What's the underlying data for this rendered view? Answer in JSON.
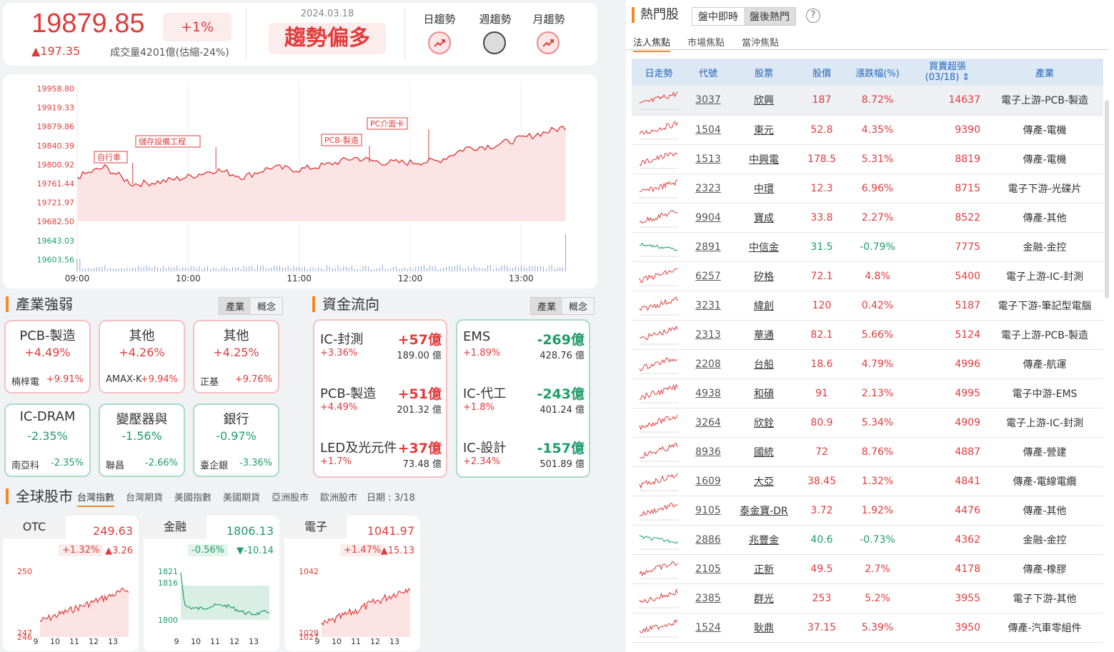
{
  "header": {
    "index_value": "19879.85",
    "index_pct": "+1%",
    "index_change": "▲197.35",
    "volume": "成交量4201億(估縮-24%)",
    "date": "2024.03.18",
    "trend": "趨勢偏多",
    "trend_labels": [
      "日趨勢",
      "週趨勢",
      "月趨勢"
    ],
    "trend_states": [
      "up",
      "neutral",
      "up"
    ]
  },
  "main_chart": {
    "y_labels": [
      "19958.80",
      "19919.33",
      "19879.86",
      "19840.39",
      "19800.92",
      "19761.44",
      "19721.97",
      "19682.50",
      "19643.03",
      "19603.56"
    ],
    "x_labels": [
      "09:00",
      "10:00",
      "11:00",
      "12:00",
      "13:00"
    ],
    "annotations": [
      "自行車",
      "儲存設備工程",
      "PCB-製造",
      "PC介面卡"
    ]
  },
  "chart_data": {
    "type": "line",
    "title": "",
    "x_range": [
      "09:00",
      "13:30"
    ],
    "ylim": [
      19682.5,
      19958.8
    ],
    "series": [
      {
        "name": "",
        "x": [
          "09:00",
          "09:15",
          "09:30",
          "09:45",
          "10:00",
          "10:15",
          "10:30",
          "10:45",
          "11:00",
          "11:15",
          "11:30",
          "11:45",
          "12:00",
          "12:15",
          "12:30",
          "12:45",
          "13:00",
          "13:15",
          "13:25"
        ],
        "values": [
          19775,
          19795,
          19760,
          19765,
          19775,
          19790,
          19775,
          19795,
          19790,
          19800,
          19815,
          19805,
          19805,
          19808,
          19835,
          19840,
          19855,
          19870,
          19880
        ]
      }
    ]
  },
  "industry": {
    "title": "產業強弱",
    "tabs": [
      "產業",
      "概念"
    ],
    "items": [
      {
        "name": "PCB-製造",
        "pct": "+4.49%",
        "stock": "楠梓電",
        "stock_pct": "+9.91%",
        "dir": "up"
      },
      {
        "name": "其他",
        "pct": "+4.26%",
        "stock": "AMAX-K",
        "stock_pct": "+9.94%",
        "dir": "up"
      },
      {
        "name": "其他",
        "pct": "+4.25%",
        "stock": "正基",
        "stock_pct": "+9.76%",
        "dir": "up"
      },
      {
        "name": "IC-DRAM",
        "pct": "-2.35%",
        "stock": "南亞科",
        "stock_pct": "-2.35%",
        "dir": "dn"
      },
      {
        "name": "變壓器與",
        "pct": "-1.56%",
        "stock": "聯昌",
        "stock_pct": "-2.66%",
        "dir": "dn"
      },
      {
        "name": "銀行",
        "pct": "-0.97%",
        "stock": "臺企銀",
        "stock_pct": "-3.36%",
        "dir": "dn"
      }
    ]
  },
  "fund_flow": {
    "title": "資金流向",
    "tabs": [
      "產業",
      "概念"
    ],
    "inflow": [
      {
        "name": "IC-封測",
        "amount": "+57億",
        "pct": "+3.36%",
        "base": "189.00 億"
      },
      {
        "name": "PCB-製造",
        "amount": "+51億",
        "pct": "+4.49%",
        "base": "201.32 億"
      },
      {
        "name": "LED及光元件",
        "amount": "+37億",
        "pct": "+1.7%",
        "base": "73.48 億"
      }
    ],
    "outflow": [
      {
        "name": "EMS",
        "amount": "-269億",
        "pct": "+1.89%",
        "base": "428.76 億"
      },
      {
        "name": "IC-代工",
        "amount": "-243億",
        "pct": "+1.8%",
        "base": "401.24 億"
      },
      {
        "name": "IC-設計",
        "amount": "-157億",
        "pct": "+2.34%",
        "base": "501.89 億"
      }
    ]
  },
  "global": {
    "title": "全球股市",
    "tabs": [
      "台灣指數",
      "台灣期貨",
      "美國指數",
      "美國期貨",
      "亞洲股市",
      "歐洲股市"
    ],
    "date": "日期 : 3/18",
    "cards": [
      {
        "name": "OTC",
        "value": "249.63",
        "pct": "+1.32%",
        "chg": "▲3.26",
        "dir": "up",
        "y_top": "250",
        "y_mid": "247",
        "y_bot": "246",
        "x": [
          "9",
          "10",
          "11",
          "12",
          "13"
        ]
      },
      {
        "name": "金融",
        "value": "1806.13",
        "pct": "-0.56%",
        "chg": "▼-10.14",
        "dir": "dn",
        "y_top": "1821",
        "y_mid": "1816",
        "y_bot": "1800",
        "x": [
          "9",
          "10",
          "11",
          "12",
          "13"
        ]
      },
      {
        "name": "電子",
        "value": "1041.97",
        "pct": "+1.47%",
        "chg": "▲15.13",
        "dir": "up",
        "y_top": "1042",
        "y_mid": "1029",
        "y_bot": "1027",
        "x": [
          "9",
          "10",
          "11",
          "12",
          "13"
        ]
      }
    ]
  },
  "hot": {
    "title": "熱門股",
    "toggle": [
      "盤中即時",
      "盤後熱門"
    ],
    "help": "?",
    "subtabs": [
      "法人焦點",
      "市場焦點",
      "當沖焦點"
    ],
    "columns": [
      "日走勢",
      "代號",
      "股票",
      "股價",
      "漲跌幅(%)",
      "買賣超張",
      "(03/18)",
      "產業"
    ],
    "rows": [
      {
        "code": "3037",
        "name": "欣興",
        "price": "187",
        "pct": "8.72%",
        "net": "14637",
        "ind": "電子上游-PCB-製造",
        "dir": "up"
      },
      {
        "code": "1504",
        "name": "東元",
        "price": "52.8",
        "pct": "4.35%",
        "net": "9390",
        "ind": "傳產-電機",
        "dir": "up"
      },
      {
        "code": "1513",
        "name": "中興電",
        "price": "178.5",
        "pct": "5.31%",
        "net": "8819",
        "ind": "傳產-電機",
        "dir": "up"
      },
      {
        "code": "2323",
        "name": "中環",
        "price": "12.3",
        "pct": "6.96%",
        "net": "8715",
        "ind": "電子下游-光碟片",
        "dir": "up"
      },
      {
        "code": "9904",
        "name": "寶成",
        "price": "33.8",
        "pct": "2.27%",
        "net": "8522",
        "ind": "傳產-其他",
        "dir": "up"
      },
      {
        "code": "2891",
        "name": "中信金",
        "price": "31.5",
        "pct": "-0.79%",
        "net": "7775",
        "ind": "金融-金控",
        "dir": "dn"
      },
      {
        "code": "6257",
        "name": "矽格",
        "price": "72.1",
        "pct": "4.8%",
        "net": "5400",
        "ind": "電子上游-IC-封測",
        "dir": "up"
      },
      {
        "code": "3231",
        "name": "緯創",
        "price": "120",
        "pct": "0.42%",
        "net": "5187",
        "ind": "電子下游-筆記型電腦",
        "dir": "up"
      },
      {
        "code": "2313",
        "name": "華通",
        "price": "82.1",
        "pct": "5.66%",
        "net": "5124",
        "ind": "電子上游-PCB-製造",
        "dir": "up"
      },
      {
        "code": "2208",
        "name": "台船",
        "price": "18.6",
        "pct": "4.79%",
        "net": "4996",
        "ind": "傳產-航運",
        "dir": "up"
      },
      {
        "code": "4938",
        "name": "和碩",
        "price": "91",
        "pct": "2.13%",
        "net": "4995",
        "ind": "電子中游-EMS",
        "dir": "up"
      },
      {
        "code": "3264",
        "name": "欣銓",
        "price": "80.9",
        "pct": "5.34%",
        "net": "4909",
        "ind": "電子上游-IC-封測",
        "dir": "up"
      },
      {
        "code": "8936",
        "name": "國統",
        "price": "72",
        "pct": "8.76%",
        "net": "4887",
        "ind": "傳產-營建",
        "dir": "up"
      },
      {
        "code": "1609",
        "name": "大亞",
        "price": "38.45",
        "pct": "1.32%",
        "net": "4841",
        "ind": "傳產-電線電纜",
        "dir": "up"
      },
      {
        "code": "9105",
        "name": "泰金寶-DR",
        "price": "3.72",
        "pct": "1.92%",
        "net": "4476",
        "ind": "傳產-其他",
        "dir": "up"
      },
      {
        "code": "2886",
        "name": "兆豐金",
        "price": "40.6",
        "pct": "-0.73%",
        "net": "4362",
        "ind": "金融-金控",
        "dir": "dn"
      },
      {
        "code": "2105",
        "name": "正新",
        "price": "49.5",
        "pct": "2.7%",
        "net": "4178",
        "ind": "傳產-橡膠",
        "dir": "up"
      },
      {
        "code": "2385",
        "name": "群光",
        "price": "253",
        "pct": "5.2%",
        "net": "3955",
        "ind": "電子下游-其他",
        "dir": "up"
      },
      {
        "code": "1524",
        "name": "耿鼎",
        "price": "37.15",
        "pct": "5.39%",
        "net": "3950",
        "ind": "傳產-汽車零組件",
        "dir": "up"
      }
    ]
  },
  "colors": {
    "up": "#e03c3c",
    "down": "#1e9c6a",
    "accent": "#f08a24",
    "header_blue": "#dde8f5"
  }
}
